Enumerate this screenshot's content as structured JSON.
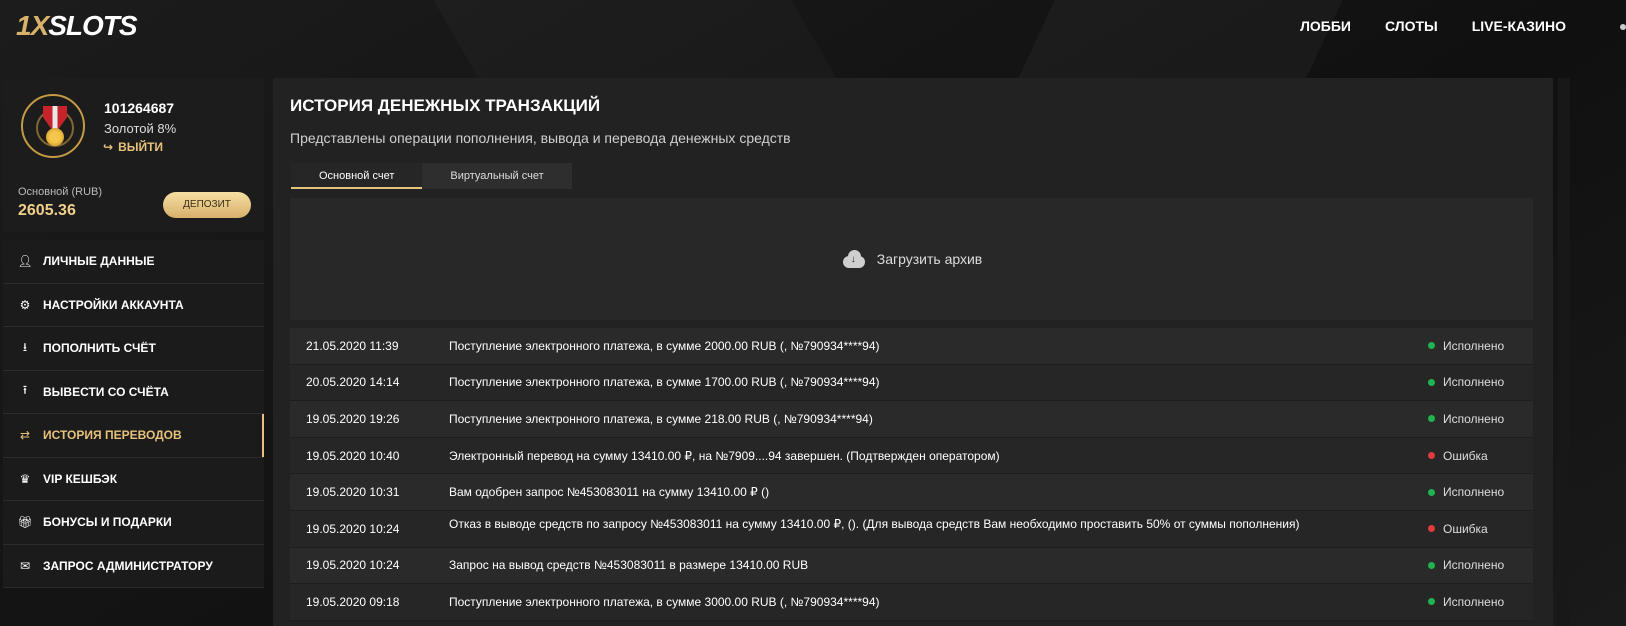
{
  "brand": {
    "logo_prefix": "1X",
    "logo_suffix": "SLOTS"
  },
  "nav": {
    "items": [
      "ЛОББИ",
      "СЛОТЫ",
      "LIVE-КАЗИНО"
    ]
  },
  "profile": {
    "user_id": "101264687",
    "level": "Золотой 8%",
    "logout_label": "ВЫЙТИ",
    "balance_label": "Основной (RUB)",
    "balance_value": "2605.36",
    "deposit_label": "ДЕПОЗИТ"
  },
  "menu": {
    "items": [
      {
        "label": "ЛИЧНЫЕ ДАННЫЕ",
        "icon": "user-plus-icon"
      },
      {
        "label": "НАСТРОЙКИ АККАУНТА",
        "icon": "gears-icon"
      },
      {
        "label": "ПОПОЛНИТЬ СЧЁТ",
        "icon": "download-icon"
      },
      {
        "label": "ВЫВЕСТИ СО СЧЁТА",
        "icon": "upload-icon"
      },
      {
        "label": "ИСТОРИЯ ПЕРЕВОДОВ",
        "icon": "exchange-icon",
        "active": true
      },
      {
        "label": "VIP КЕШБЭК",
        "icon": "crown-icon"
      },
      {
        "label": "БОНУСЫ И ПОДАРКИ",
        "icon": "gift-icon"
      },
      {
        "label": "ЗАПРОС АДМИНИСТРАТОРУ",
        "icon": "mail-icon"
      }
    ]
  },
  "main": {
    "title": "ИСТОРИЯ ДЕНЕЖНЫХ ТРАНЗАКЦИЙ",
    "subtitle": "Представлены операции пополнения, вывода и перевода денежных средств",
    "tabs": [
      "Основной счет",
      "Виртуальный счет"
    ],
    "upload_label": "Загрузить архив"
  },
  "transactions": [
    {
      "date": "21.05.2020 11:39",
      "desc": "Поступление электронного платежа, в сумме 2000.00 RUB (, №790934****94)",
      "status": "Исполнено",
      "status_type": "ok"
    },
    {
      "date": "20.05.2020 14:14",
      "desc": "Поступление электронного платежа, в сумме 1700.00 RUB (, №790934****94)",
      "status": "Исполнено",
      "status_type": "ok"
    },
    {
      "date": "19.05.2020 19:26",
      "desc": "Поступление электронного платежа, в сумме 218.00 RUB (, №790934****94)",
      "status": "Исполнено",
      "status_type": "ok"
    },
    {
      "date": "19.05.2020 10:40",
      "desc": "Электронный перевод на сумму 13410.00 ₽, на №7909....94 завершен. (Подтвержден оператором)",
      "status": "Ошибка",
      "status_type": "err"
    },
    {
      "date": "19.05.2020 10:31",
      "desc": "Вам одобрен запрос №453083011 на сумму 13410.00 ₽ ()",
      "status": "Исполнено",
      "status_type": "ok"
    },
    {
      "date": "19.05.2020 10:24",
      "desc": "Отказ в выводе средств по запросу №453083011 на сумму 13410.00 ₽, (). (Для вывода средств Вам необходимо проставить 50% от суммы пополнения)",
      "status": "Ошибка",
      "status_type": "err",
      "top": true
    },
    {
      "date": "19.05.2020 10:24",
      "desc": "Запрос на вывод средств №453083011 в размере 13410.00 RUB",
      "status": "Исполнено",
      "status_type": "ok"
    },
    {
      "date": "19.05.2020 09:18",
      "desc": "Поступление электронного платежа, в сумме 3000.00 RUB (, №790934****94)",
      "status": "Исполнено",
      "status_type": "ok"
    }
  ],
  "colors": {
    "accent": "#e6c27a",
    "ok": "#1fb352",
    "err": "#e23b3b"
  }
}
